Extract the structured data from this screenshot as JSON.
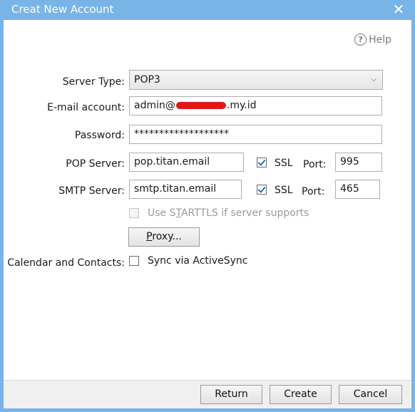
{
  "window": {
    "title": "Creat New Account",
    "close_icon": "close-icon"
  },
  "help": {
    "label": "Help",
    "icon": "help-icon",
    "icon_glyph": "?"
  },
  "form": {
    "server_type": {
      "label": "Server Type:",
      "value": "POP3"
    },
    "email": {
      "label": "E-mail account:",
      "value_prefix": "admin@",
      "value_suffix": ".my.id"
    },
    "password": {
      "label": "Password:",
      "value": "*******************"
    },
    "pop_server": {
      "label": "POP Server:",
      "value": "pop.titan.email",
      "ssl_label": "SSL",
      "ssl_checked": true,
      "port_label": "Port:",
      "port": "995"
    },
    "smtp_server": {
      "label": "SMTP Server:",
      "value": "smtp.titan.email",
      "ssl_label": "SSL",
      "ssl_checked": true,
      "port_label": "Port:",
      "port": "465"
    },
    "starttls": {
      "label_pre": "Use S",
      "label_u": "T",
      "label_post": "ARTTLS if server supports",
      "checked": false,
      "disabled": true
    },
    "proxy_button": {
      "label_u": "P",
      "label_post": "roxy..."
    },
    "calendar": {
      "label": "Calendar and Contacts:",
      "option": "Sync via ActiveSync",
      "checked": false
    }
  },
  "footer": {
    "return_label": "Return",
    "create_label": "Create",
    "cancel_label": "Cancel"
  },
  "colors": {
    "titlebar": "#78b4e6",
    "redaction": "#e01818",
    "check": "#2a6fbe"
  }
}
